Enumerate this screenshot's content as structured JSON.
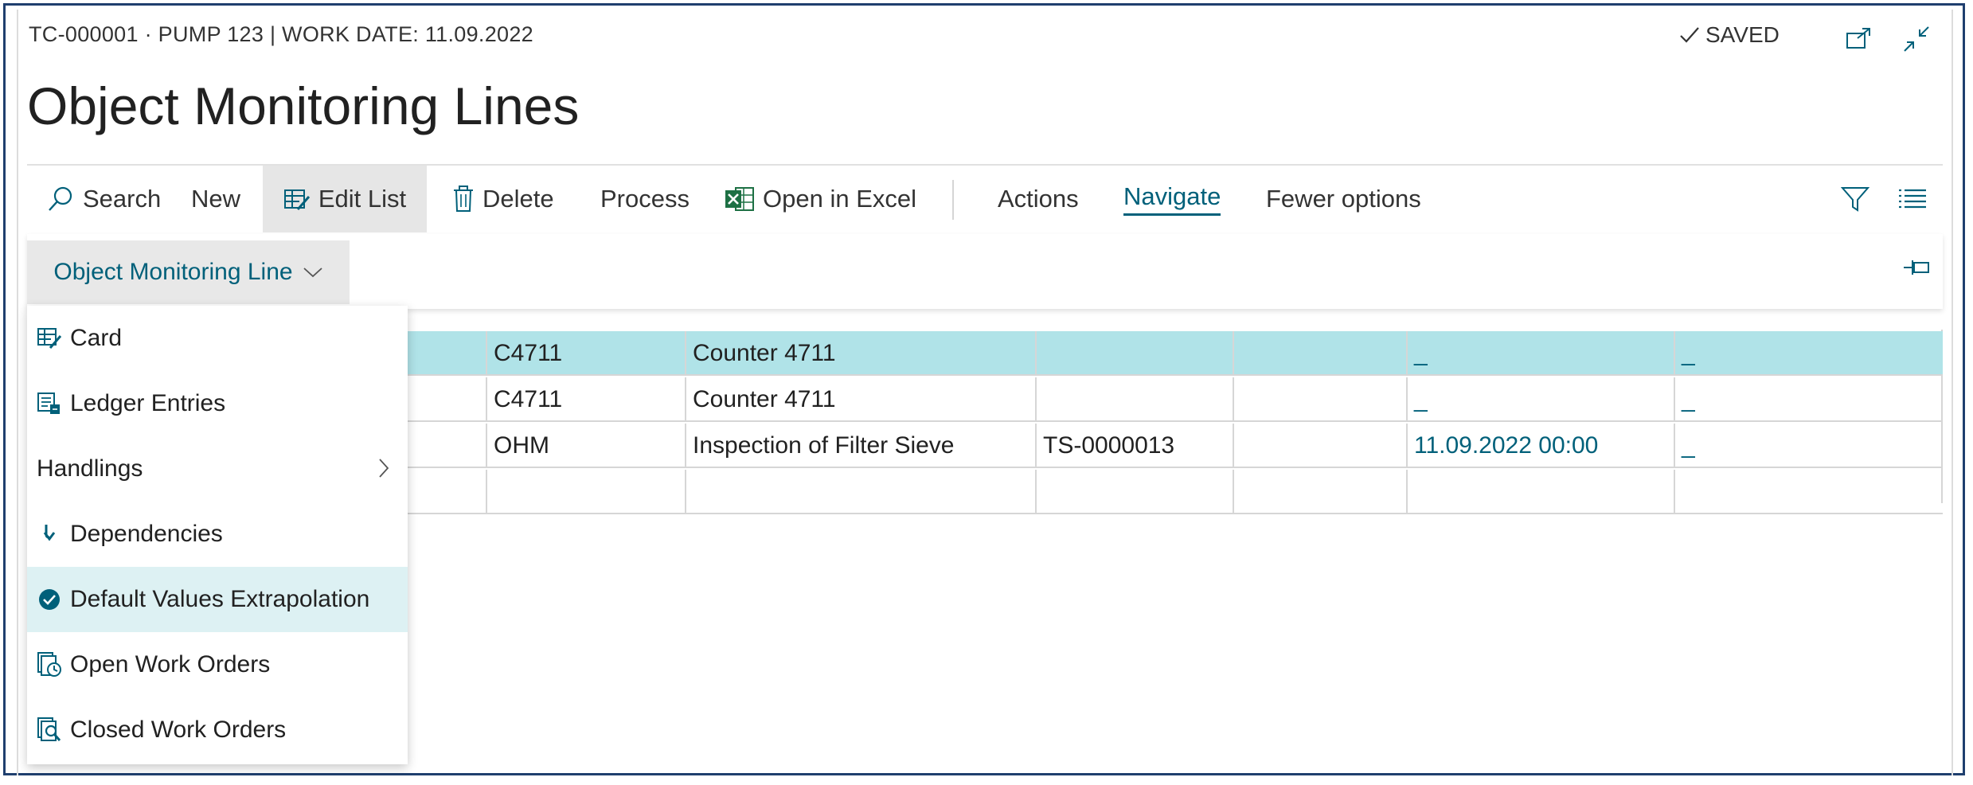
{
  "header": {
    "breadcrumb": "TC-000001 · PUMP 123 | WORK DATE: 11.09.2022",
    "saved_label": "SAVED",
    "title": "Object Monitoring Lines"
  },
  "toolbar": {
    "search": "Search",
    "new": "New",
    "edit_list": "Edit List",
    "delete": "Delete",
    "process": "Process",
    "open_in_excel": "Open in Excel",
    "actions": "Actions",
    "navigate": "Navigate",
    "fewer_options": "Fewer options"
  },
  "subbar": {
    "menu_label": "Object Monitoring Line"
  },
  "menu": {
    "items": [
      {
        "label": "Card",
        "icon": "card-icon"
      },
      {
        "label": "Ledger Entries",
        "icon": "ledger-icon"
      },
      {
        "label": "Handlings",
        "icon": "chevron-right-icon"
      },
      {
        "label": "Dependencies",
        "icon": "dependency-arrow-icon"
      },
      {
        "label": "Default Values Extrapolation",
        "icon": "check-circle-icon"
      },
      {
        "label": "Open Work Orders",
        "icon": "open-orders-icon"
      },
      {
        "label": "Closed Work Orders",
        "icon": "closed-orders-icon"
      }
    ]
  },
  "grid": {
    "rows": [
      {
        "template_code": "C4711",
        "description": "Counter 4711",
        "no": "",
        "status": "",
        "last_action": "_",
        "time": "_"
      },
      {
        "template_code": "C4711",
        "description": "Counter 4711",
        "no": "",
        "status": "",
        "last_action": "_",
        "time": "_"
      },
      {
        "template_code": "OHM",
        "description": "Inspection of Filter Sieve",
        "no": "TS-0000013",
        "status": "",
        "last_action": "11.09.2022 00:00",
        "time": "_"
      },
      {
        "template_code": "",
        "description": "",
        "no": "",
        "status": "",
        "last_action": "",
        "time": ""
      }
    ]
  },
  "colors": {
    "accent": "#00607a",
    "selected_row": "#b0e3e8",
    "menu_highlight": "#ddf1f3",
    "frame": "#1f3f6e",
    "excel_green": "#1d7044"
  }
}
